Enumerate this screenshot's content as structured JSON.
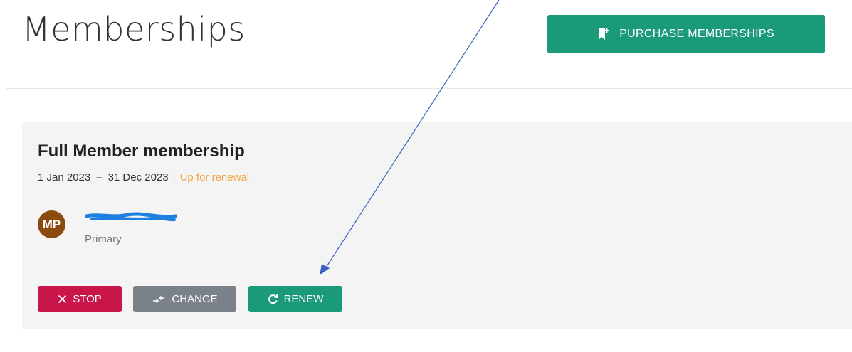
{
  "page": {
    "title": "Memberships",
    "purchase_button": {
      "label": "PURCHASE MEMBERSHIPS",
      "icon": "bookmark-plus-icon"
    }
  },
  "membership": {
    "title": "Full Member membership",
    "start_date": "1 Jan 2023",
    "date_separator": "–",
    "end_date": "31 Dec 2023",
    "status": "Up for renewal",
    "member": {
      "initials": "MP",
      "role": "Primary"
    },
    "actions": {
      "stop": {
        "label": "STOP",
        "icon": "close-icon"
      },
      "change": {
        "label": "CHANGE",
        "icon": "swap-arrows-icon"
      },
      "renew": {
        "label": "RENEW",
        "icon": "refresh-icon"
      }
    }
  },
  "colors": {
    "accent_green": "#1b9a7a",
    "stop_red": "#c8154a",
    "change_gray": "#7b8188",
    "status_orange": "#f2a540",
    "avatar_brown": "#8b4a0e",
    "annotation_blue": "#3a62c0",
    "redaction_blue": "#1f7fe0"
  }
}
